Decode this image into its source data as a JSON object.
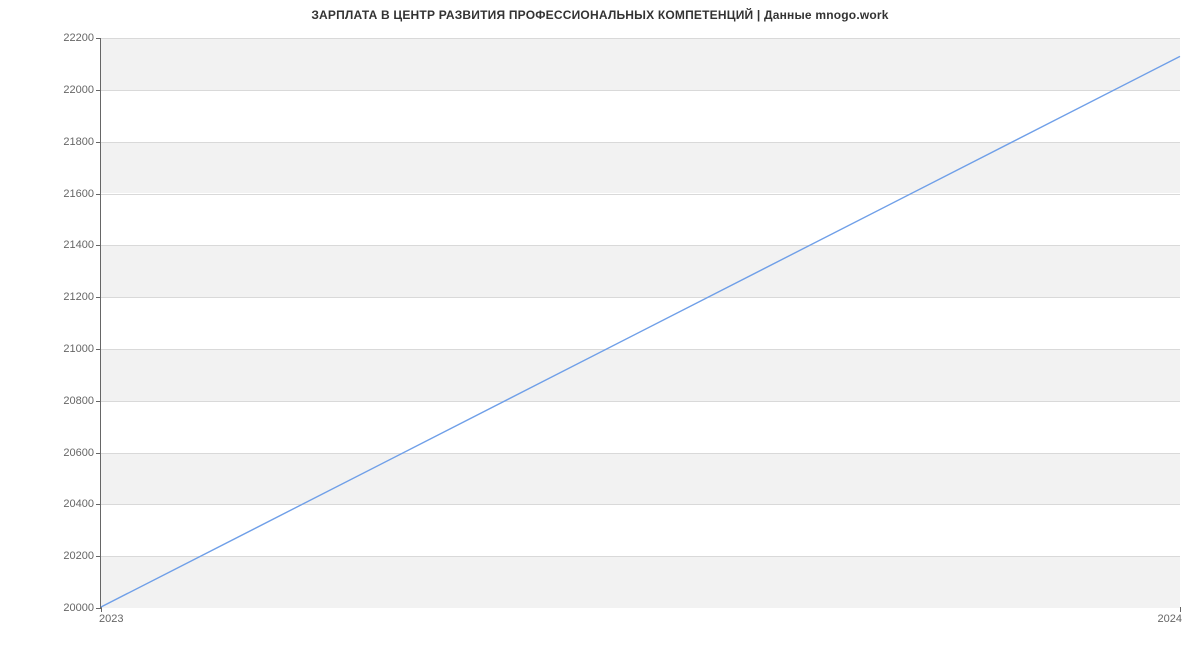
{
  "chart_data": {
    "type": "line",
    "title": "ЗАРПЛАТА В ЦЕНТР РАЗВИТИЯ ПРОФЕССИОНАЛЬНЫХ КОМПЕТЕНЦИЙ | Данные mnogo.work",
    "xlabel": "",
    "ylabel": "",
    "x": [
      2023,
      2024
    ],
    "x_ticks": [
      "2023",
      "2024"
    ],
    "y_ticks": [
      20000,
      20200,
      20400,
      20600,
      20800,
      21000,
      21200,
      21400,
      21600,
      21800,
      22000,
      22200
    ],
    "ylim": [
      20000,
      22200
    ],
    "xlim": [
      2023,
      2024
    ],
    "series": [
      {
        "name": "salary",
        "color": "#6f9fe8",
        "points": [
          [
            2023,
            20000
          ],
          [
            2024,
            22130
          ]
        ]
      }
    ]
  }
}
